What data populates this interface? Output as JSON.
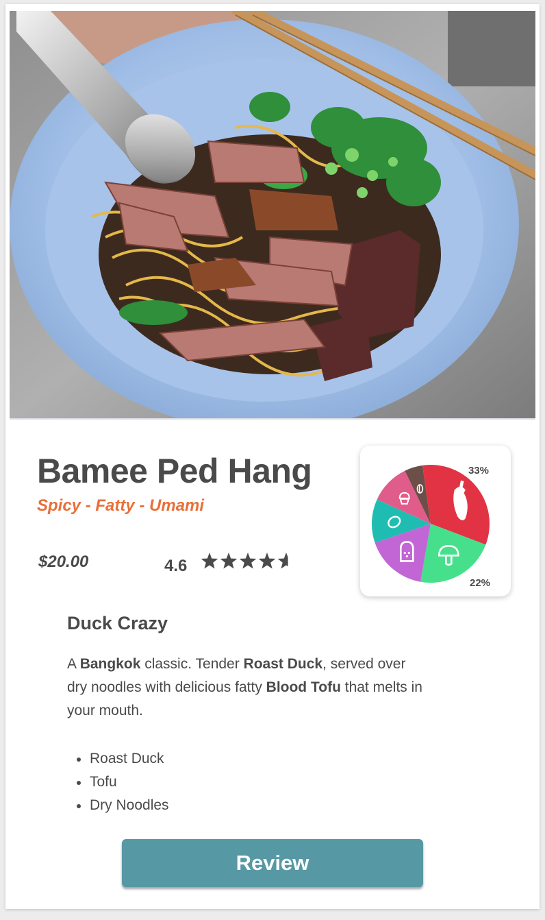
{
  "dish": {
    "name": "Bamee Ped Hang",
    "flavors": "Spicy - Fatty - Umami",
    "price": "$20.00",
    "rating": "4.6",
    "rating_value": 4.6,
    "rating_max": 5
  },
  "hero": {
    "image_name": "duck-noodle-bowl-photo"
  },
  "flavor_chart": {
    "chart_data": {
      "type": "pie",
      "slices": [
        {
          "name": "spicy",
          "value": 33,
          "color": "#e23344",
          "icon": "chili-pepper-icon"
        },
        {
          "name": "umami",
          "value": 22,
          "color": "#46e08c",
          "icon": "mushroom-icon"
        },
        {
          "name": "salty",
          "value": 17,
          "color": "#c266d6",
          "icon": "salt-shaker-icon"
        },
        {
          "name": "sour",
          "value": 12,
          "color": "#1fbdb1",
          "icon": "lemon-icon"
        },
        {
          "name": "sweet",
          "value": 11,
          "color": "#e05c8a",
          "icon": "cupcake-icon"
        },
        {
          "name": "bitter",
          "value": 5,
          "color": "#6b4f48",
          "icon": "coffee-bean-icon"
        }
      ],
      "labels": {
        "top": "33%",
        "bottom": "22%"
      }
    }
  },
  "details": {
    "title": "Duck Crazy",
    "description_parts": {
      "p1": "A ",
      "b1": "Bangkok",
      "p2": " classic. Tender ",
      "b2": "Roast Duck",
      "p3": ", served over dry noodles with delicious fatty ",
      "b3": "Blood Tofu",
      "p4": " that melts in your mouth."
    },
    "ingredients": [
      "Roast Duck",
      "Tofu",
      "Dry Noodles"
    ]
  },
  "actions": {
    "review_label": "Review"
  },
  "colors": {
    "accent_orange": "#e8703a",
    "button_teal": "#5798a5",
    "text_dark": "#4a4a4a"
  }
}
